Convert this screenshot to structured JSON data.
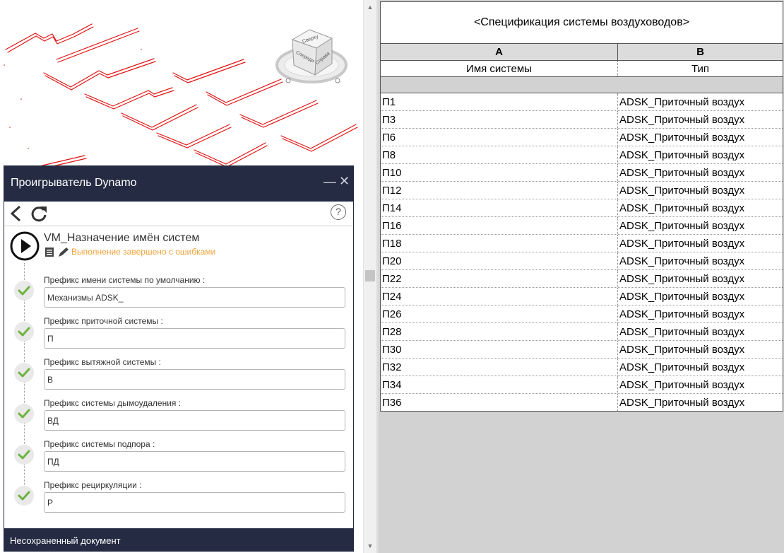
{
  "dynamo_player": {
    "title": "Проигрыватель Dynamo",
    "minimize_glyph": "—",
    "close_glyph": "✕",
    "help_glyph": "?",
    "script_name": "VM_Назначение имён систем",
    "status": "Выполнение завершено с ошибками",
    "status_color": "#f0a33a",
    "inputs": [
      {
        "label": "Префикс имени системы по умолчанию :",
        "value": "Механизмы ADSK_"
      },
      {
        "label": "Префикс приточной системы :",
        "value": "П"
      },
      {
        "label": "Префикс вытяжной системы :",
        "value": "В"
      },
      {
        "label": "Префикс системы дымоудаления :",
        "value": "ВД"
      },
      {
        "label": "Префикс системы подпора :",
        "value": "ПД"
      },
      {
        "label": "Префикс рециркуляции :",
        "value": "Р"
      }
    ],
    "footer": "Несохраненный документ",
    "icons": {
      "back": "chevron-left-icon",
      "refresh": "refresh-icon",
      "help": "help-icon",
      "play": "play-icon",
      "check": "check-icon",
      "edit": "pencil-icon",
      "doc": "document-icon"
    }
  },
  "viewcube": {
    "faces": [
      "Сверху",
      "Справа",
      "Спереди"
    ]
  },
  "schedule": {
    "title": "<Спецификация системы воздуховодов>",
    "column_letters": [
      "A",
      "B"
    ],
    "column_headers": [
      "Имя системы",
      "Тип"
    ],
    "rows": [
      [
        "П1",
        "ADSK_Приточный воздух"
      ],
      [
        "П3",
        "ADSK_Приточный воздух"
      ],
      [
        "П6",
        "ADSK_Приточный воздух"
      ],
      [
        "П8",
        "ADSK_Приточный воздух"
      ],
      [
        "П10",
        "ADSK_Приточный воздух"
      ],
      [
        "П12",
        "ADSK_Приточный воздух"
      ],
      [
        "П14",
        "ADSK_Приточный воздух"
      ],
      [
        "П16",
        "ADSK_Приточный воздух"
      ],
      [
        "П18",
        "ADSK_Приточный воздух"
      ],
      [
        "П20",
        "ADSK_Приточный воздух"
      ],
      [
        "П22",
        "ADSK_Приточный воздух"
      ],
      [
        "П24",
        "ADSK_Приточный воздух"
      ],
      [
        "П26",
        "ADSK_Приточный воздух"
      ],
      [
        "П28",
        "ADSK_Приточный воздух"
      ],
      [
        "П30",
        "ADSK_Приточный воздух"
      ],
      [
        "П32",
        "ADSK_Приточный воздух"
      ],
      [
        "П34",
        "ADSK_Приточный воздух"
      ],
      [
        "П36",
        "ADSK_Приточный воздух"
      ]
    ]
  },
  "colors": {
    "duct": "#e01414",
    "panel_header": "#252b43",
    "check": "#6db33f"
  }
}
